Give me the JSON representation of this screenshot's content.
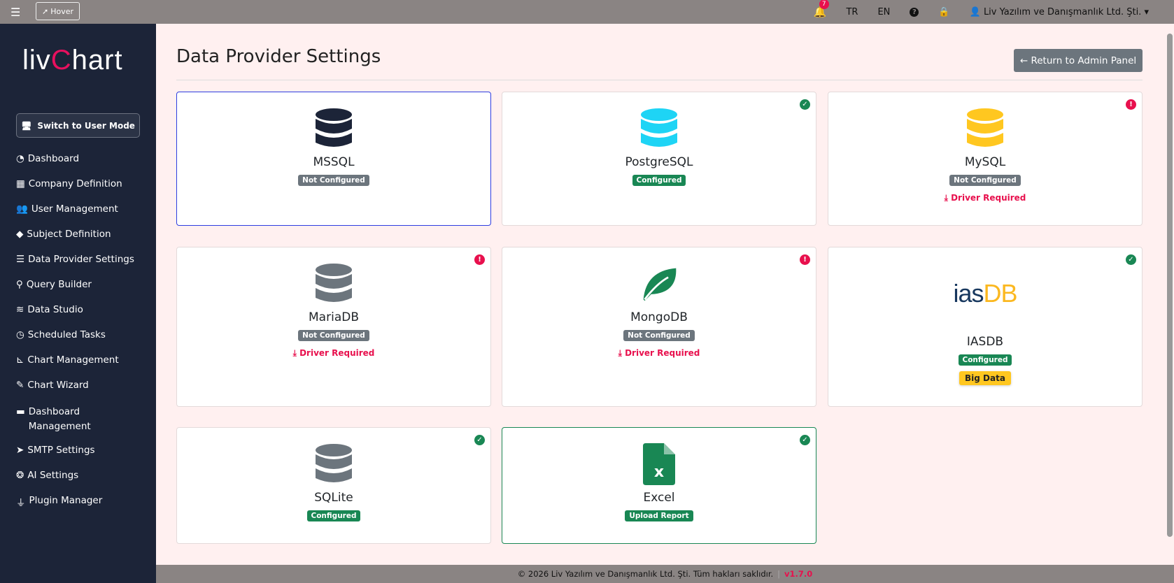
{
  "topbar": {
    "hover_label": "Hover",
    "notif_count": "7",
    "lang_tr": "TR",
    "lang_en": "EN",
    "user": "Liv Yazılım ve Danışmanlık Ltd. Şti."
  },
  "sidebar": {
    "logo": "livChart",
    "switch_label": "Switch to User Mode",
    "items": [
      {
        "label": "Dashboard",
        "icon": "gauge-icon",
        "glyph": "◔"
      },
      {
        "label": "Company Definition",
        "icon": "building-icon",
        "glyph": "▦"
      },
      {
        "label": "User Management",
        "icon": "users-icon",
        "glyph": "👥"
      },
      {
        "label": "Subject Definition",
        "icon": "tags-icon",
        "glyph": "◆"
      },
      {
        "label": "Data Provider Settings",
        "icon": "server-icon",
        "glyph": "☰"
      },
      {
        "label": "Query Builder",
        "icon": "search-icon",
        "glyph": "⚲"
      },
      {
        "label": "Data Studio",
        "icon": "layers-icon",
        "glyph": "≋"
      },
      {
        "label": "Scheduled Tasks",
        "icon": "clock-icon",
        "glyph": "◷"
      },
      {
        "label": "Chart Management",
        "icon": "chart-line-icon",
        "glyph": "⊾"
      },
      {
        "label": "Chart Wizard",
        "icon": "pen-icon",
        "glyph": "✎"
      },
      {
        "label": "Dashboard Management",
        "icon": "dashboard-icon",
        "glyph": "▬"
      },
      {
        "label": "SMTP Settings",
        "icon": "paper-plane-icon",
        "glyph": "➤"
      },
      {
        "label": "AI Settings",
        "icon": "brain-icon",
        "glyph": "❂"
      },
      {
        "label": "Plugin Manager",
        "icon": "plug-icon",
        "glyph": "⏚"
      }
    ]
  },
  "page": {
    "title": "Data Provider Settings",
    "return_label": "← Return to Admin Panel"
  },
  "providers": [
    {
      "name": "MSSQL",
      "status": "Not Configured",
      "ok": false,
      "alert": false,
      "color": "#1c2438"
    },
    {
      "name": "PostgreSQL",
      "status": "Configured",
      "ok": true,
      "alert": false,
      "color": "#1ed4f5"
    },
    {
      "name": "MySQL",
      "status": "Not Configured",
      "ok": false,
      "alert": true,
      "driver": "Driver Required",
      "color": "#ffc720"
    },
    {
      "name": "MariaDB",
      "status": "Not Configured",
      "ok": false,
      "alert": true,
      "driver": "Driver Required",
      "color": "#6c757d"
    },
    {
      "name": "MongoDB",
      "status": "Not Configured",
      "ok": false,
      "alert": true,
      "driver": "Driver Required",
      "color": "#198754"
    },
    {
      "name": "IASDB",
      "status": "Configured",
      "ok": true,
      "alert": false,
      "extra": "Big Data",
      "logo_a": "ias",
      "logo_b": "DB"
    },
    {
      "name": "SQLite",
      "status": "Configured",
      "ok": true,
      "alert": false,
      "color": "#6c757d"
    },
    {
      "name": "Excel",
      "status": "Upload Report",
      "ok": true,
      "alert": false,
      "color": "#198754"
    }
  ],
  "footer": {
    "copyright": "© 2026 Liv Yazılım ve Danışmanlık Ltd. Şti. Tüm hakları saklıdır.",
    "version": "v1.7.0"
  }
}
